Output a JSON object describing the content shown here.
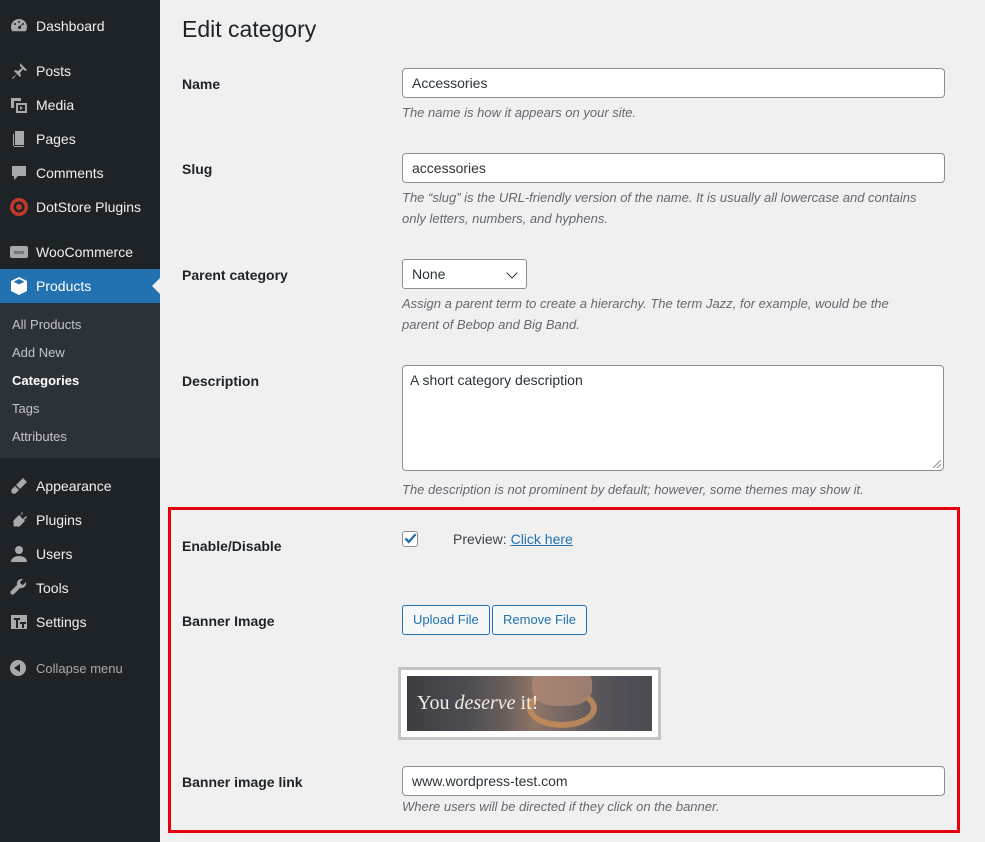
{
  "sidebar": {
    "items": [
      {
        "label": "Dashboard",
        "icon": "dashboard-icon"
      },
      {
        "label": "Posts",
        "icon": "pin-icon"
      },
      {
        "label": "Media",
        "icon": "media-icon"
      },
      {
        "label": "Pages",
        "icon": "pages-icon"
      },
      {
        "label": "Comments",
        "icon": "comment-icon"
      },
      {
        "label": "DotStore Plugins",
        "icon": "dotstore-icon"
      },
      {
        "label": "WooCommerce",
        "icon": "woocommerce-icon"
      },
      {
        "label": "Products",
        "icon": "box-icon"
      },
      {
        "label": "Appearance",
        "icon": "paintbrush-icon"
      },
      {
        "label": "Plugins",
        "icon": "plugin-icon"
      },
      {
        "label": "Users",
        "icon": "user-icon"
      },
      {
        "label": "Tools",
        "icon": "wrench-icon"
      },
      {
        "label": "Settings",
        "icon": "settings-icon"
      }
    ],
    "submenu": [
      "All Products",
      "Add New",
      "Categories",
      "Tags",
      "Attributes"
    ],
    "collapse_label": "Collapse menu",
    "woo_badge": "woo"
  },
  "page": {
    "title": "Edit category",
    "name_label": "Name",
    "name_value": "Accessories",
    "name_desc": "The name is how it appears on your site.",
    "slug_label": "Slug",
    "slug_value": "accessories",
    "slug_desc_1": "The “slug” is the URL-friendly version of the name. It is usually all lowercase and contains",
    "slug_desc_2": "only letters, numbers, and hyphens.",
    "parent_label": "Parent category",
    "parent_value": "None",
    "parent_desc_1": "Assign a parent term to create a hierarchy. The term Jazz, for example, would be the",
    "parent_desc_2": "parent of Bebop and Big Band.",
    "description_label": "Description",
    "description_value": "A short category description",
    "description_desc": "The description is not prominent by default; however, some themes may show it.",
    "enable_label": "Enable/Disable",
    "enable_checked": true,
    "preview_label": "Preview:",
    "preview_link": "Click here",
    "banner_label": "Banner Image",
    "upload_button": "Upload File",
    "remove_button": "Remove File",
    "banner_text_1": "You",
    "banner_text_2": "deserve",
    "banner_text_3": "it!",
    "banner_link_label": "Banner image link",
    "banner_link_value": "www.wordpress-test.com",
    "banner_link_desc": "Where users will be directed if they click on the banner."
  },
  "colors": {
    "accent": "#2271b1",
    "highlight_border": "#e3000f",
    "sidebar_bg": "#1d2327"
  }
}
